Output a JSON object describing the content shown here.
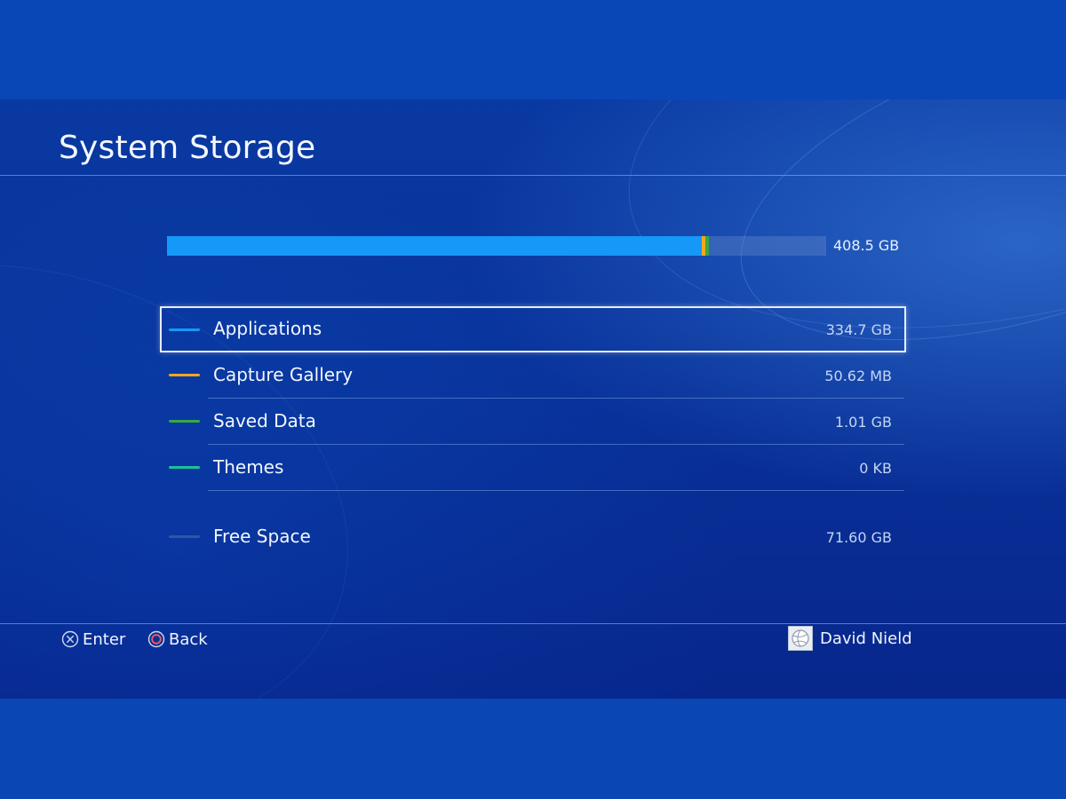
{
  "screen": {
    "title": "System Storage"
  },
  "storage": {
    "total_label": "408.5 GB",
    "segments": [
      {
        "category": "Applications",
        "fraction": 0.8118,
        "color": "#1598f8"
      },
      {
        "category": "Capture Gallery",
        "fraction": 0.0045,
        "color": "#f2a81e"
      },
      {
        "category": "Saved Data",
        "fraction": 0.0054,
        "color": "#3aa843"
      },
      {
        "category": "Themes",
        "fraction": 0.0,
        "color": "#1fbf9a"
      }
    ],
    "free_color": "#2c5eb8"
  },
  "categories": [
    {
      "label": "Applications",
      "size": "334.7 GB",
      "color": "#1598f8",
      "selected": true
    },
    {
      "label": "Capture Gallery",
      "size": "50.62 MB",
      "color": "#f2a81e",
      "selected": false
    },
    {
      "label": "Saved Data",
      "size": "1.01 GB",
      "color": "#3aa843",
      "selected": false
    },
    {
      "label": "Themes",
      "size": "0 KB",
      "color": "#1fbf9a",
      "selected": false
    }
  ],
  "free_space": {
    "label": "Free Space",
    "size": "71.60 GB",
    "color": "#2d57a8"
  },
  "footer": {
    "enter_label": "Enter",
    "enter_icon": "cross-button-icon",
    "back_label": "Back",
    "back_icon": "circle-button-icon",
    "user_name": "David Nield",
    "user_icon": "volleyball-avatar-icon"
  }
}
